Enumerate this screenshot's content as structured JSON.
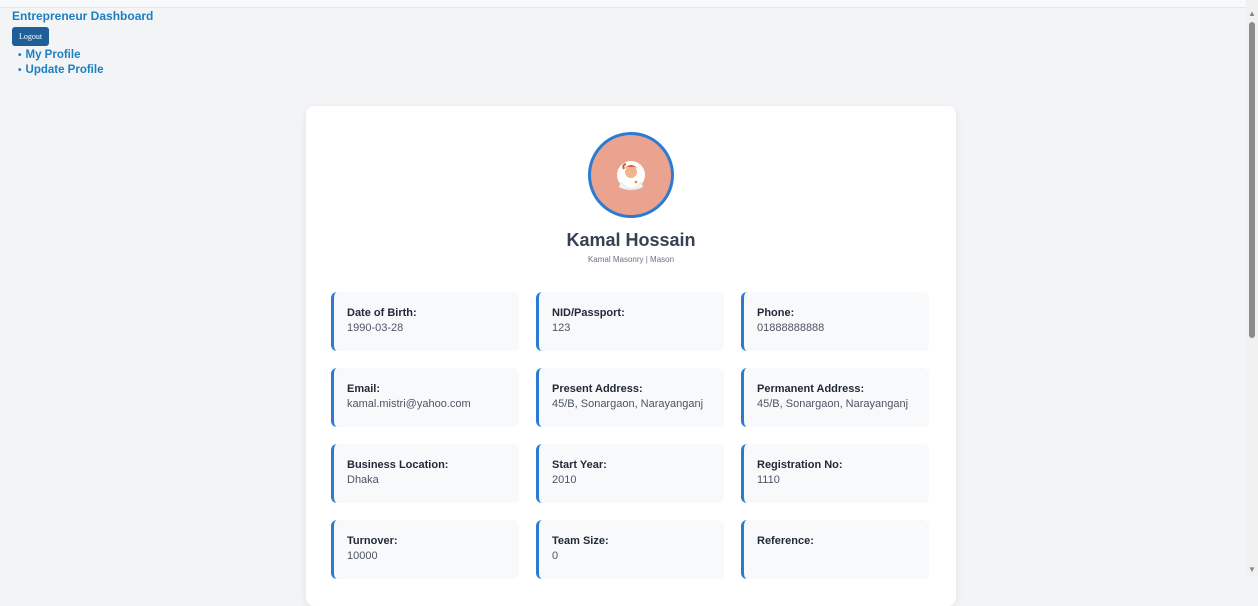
{
  "nav": {
    "brand": "Entrepreneur Dashboard",
    "logout_label": "Logout",
    "menu": [
      {
        "label": "My Profile"
      },
      {
        "label": "Update Profile"
      }
    ]
  },
  "profile": {
    "name": "Kamal Hossain",
    "subtitle": "Kamal Masonry | Mason",
    "fields": [
      {
        "label": "Date of Birth:",
        "value": "1990-03-28"
      },
      {
        "label": "NID/Passport:",
        "value": "123"
      },
      {
        "label": "Phone:",
        "value": "01888888888"
      },
      {
        "label": "Email:",
        "value": "kamal.mistri@yahoo.com"
      },
      {
        "label": "Present Address:",
        "value": "45/B, Sonargaon, Narayanganj"
      },
      {
        "label": "Permanent Address:",
        "value": "45/B, Sonargaon, Narayanganj"
      },
      {
        "label": "Business Location:",
        "value": "Dhaka"
      },
      {
        "label": "Start Year:",
        "value": "2010"
      },
      {
        "label": "Registration No:",
        "value": "1110"
      },
      {
        "label": "Turnover:",
        "value": "10000"
      },
      {
        "label": "Team Size:",
        "value": "0"
      },
      {
        "label": "Reference:",
        "value": ""
      }
    ]
  },
  "colors": {
    "accent": "#2b7bd1",
    "link": "#1d7fc0",
    "logout_bg": "#1f5f99",
    "avatar_bg": "#e9a38e"
  }
}
